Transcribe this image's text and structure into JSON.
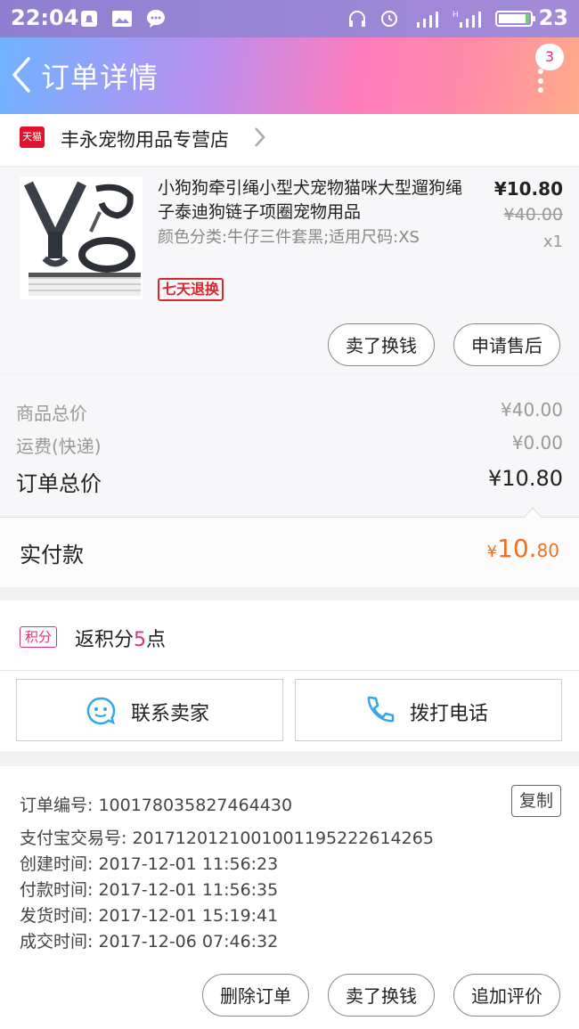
{
  "status_bar": {
    "time": "22:04",
    "battery": "23"
  },
  "header": {
    "title": "订单详情",
    "badge_count": "3"
  },
  "shop": {
    "tmall_label": "天猫",
    "name": "丰永宠物用品专营店"
  },
  "product": {
    "title": "小狗狗牵引绳小型犬宠物猫咪大型遛狗绳子泰迪狗链子项圈宠物用品",
    "spec": "颜色分类:牛仔三件套黑;适用尺码:XS",
    "tag": "七天退换",
    "price": "¥10.80",
    "original_price": "¥40.00",
    "quantity": "x1",
    "buttons": [
      "卖了换钱",
      "申请售后"
    ]
  },
  "summary": {
    "rows": [
      {
        "label": "商品总价",
        "value": "¥40.00"
      },
      {
        "label": "运费(快递)",
        "value": "¥0.00"
      }
    ],
    "total_label": "订单总价",
    "total_value": "¥10.80",
    "paid_label": "实付款",
    "paid_currency": "¥",
    "paid_int": "10.",
    "paid_dec": "80"
  },
  "points": {
    "tag": "积分",
    "text_prefix": "返积分",
    "count": "5",
    "text_suffix": "点"
  },
  "contact": {
    "seller": "联系卖家",
    "phone": "拨打电话"
  },
  "order_info": {
    "copy_label": "复制",
    "lines": [
      "订单编号: 100178035827464430",
      "支付宝交易号: 2017120121001001195222614265",
      "创建时间: 2017-12-01 11:56:23",
      "付款时间: 2017-12-01 11:56:35",
      "发货时间: 2017-12-01 15:19:41",
      "成交时间: 2017-12-06 07:46:32"
    ]
  },
  "bottom_buttons": [
    "删除订单",
    "卖了换钱",
    "追加评价"
  ],
  "colors": {
    "accent": "#e0307a",
    "pay": "#f07020",
    "tmall": "#e0142e"
  }
}
